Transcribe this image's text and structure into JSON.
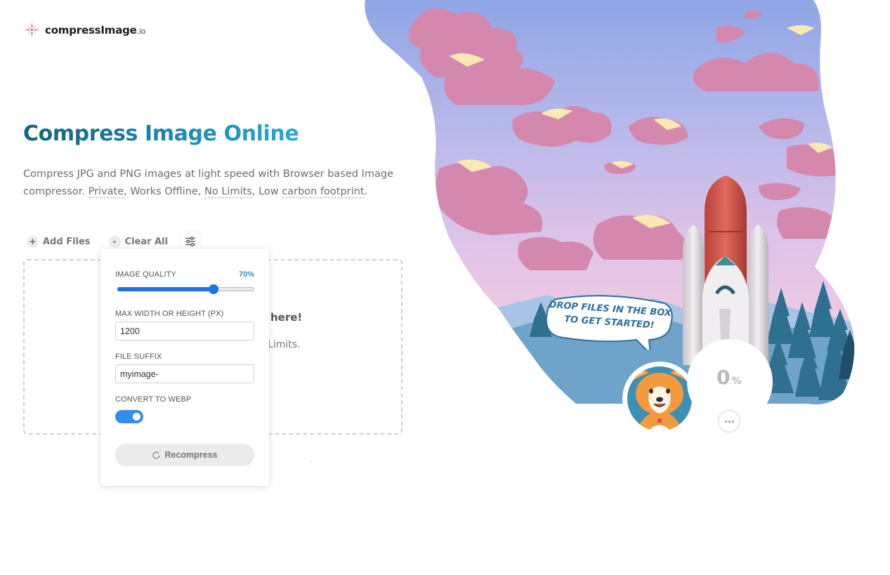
{
  "logo": {
    "name": "compressImage",
    "tld": ".io"
  },
  "hero": {
    "title": "Compress Image Online",
    "desc_part1": "Compress JPG and PNG images at light speed with Browser based Image compressor. ",
    "private": "Private",
    "desc_part2": ", Works Offline, ",
    "no_limits": "No Limits",
    "desc_part3": ", Low ",
    "carbon": "carbon footprint",
    "desc_part4": "."
  },
  "toolbar": {
    "add_icon": "+",
    "add_label": "Add Files",
    "clear_icon": "-",
    "clear_label": "Clear All",
    "settings_icon": "sliders-icon"
  },
  "dropzone": {
    "title_visible": "here!",
    "subtitle_visible": "Limits."
  },
  "settings": {
    "quality_label": "IMAGE QUALITY",
    "quality_value": "70%",
    "quality_fraction": 0.7,
    "max_label": "MAX WIDTH OR HEIGHT (PX)",
    "max_value": "1200",
    "suffix_label": "FILE SUFFIX",
    "suffix_value": "myimage-",
    "webp_label": "CONVERT TO WEBP",
    "webp_enabled": true,
    "recompress_label": "Recompress"
  },
  "illustration": {
    "speech_line1": "DROP FILES IN THE BOX",
    "speech_line2": "TO GET STARTED!",
    "progress_value": "0",
    "progress_unit": "%"
  },
  "colors": {
    "accent": "#1a73e8",
    "title_start": "#17627e",
    "title_end": "#2aa8d8",
    "logo_red": "#e34d4d"
  }
}
